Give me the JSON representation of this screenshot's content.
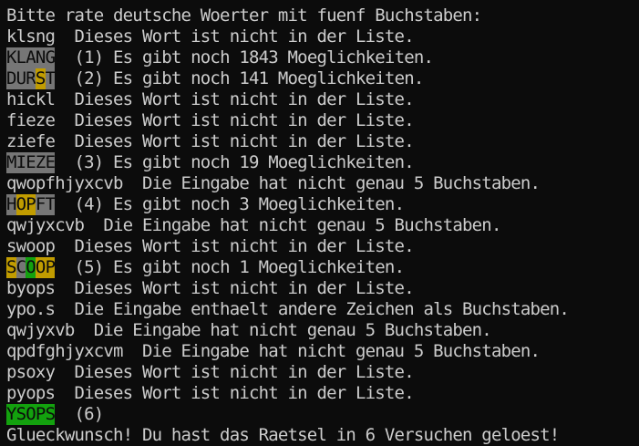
{
  "colors": {
    "background": "#0c0c0c",
    "foreground": "#cccccc",
    "absent": "#767676",
    "present": "#c19c00",
    "correct": "#13a10e"
  },
  "terminal": {
    "lines": [
      {
        "plain": "Bitte rate deutsche Woerter mit fuenf Buchstaben:"
      },
      {
        "plain": "klsng  Dieses Wort ist nicht in der Liste."
      },
      {
        "tiles": [
          {
            "ch": "K",
            "state": "absent"
          },
          {
            "ch": "L",
            "state": "absent"
          },
          {
            "ch": "A",
            "state": "absent"
          },
          {
            "ch": "N",
            "state": "absent"
          },
          {
            "ch": "G",
            "state": "absent"
          }
        ],
        "message": "  (1) Es gibt noch 1843 Moeglichkeiten."
      },
      {
        "tiles": [
          {
            "ch": "D",
            "state": "absent"
          },
          {
            "ch": "U",
            "state": "absent"
          },
          {
            "ch": "R",
            "state": "absent"
          },
          {
            "ch": "S",
            "state": "present"
          },
          {
            "ch": "T",
            "state": "absent"
          }
        ],
        "message": "  (2) Es gibt noch 141 Moeglichkeiten."
      },
      {
        "plain": "hickl  Dieses Wort ist nicht in der Liste."
      },
      {
        "plain": "fieze  Dieses Wort ist nicht in der Liste."
      },
      {
        "plain": "ziefe  Dieses Wort ist nicht in der Liste."
      },
      {
        "tiles": [
          {
            "ch": "M",
            "state": "absent"
          },
          {
            "ch": "I",
            "state": "absent"
          },
          {
            "ch": "E",
            "state": "absent"
          },
          {
            "ch": "Z",
            "state": "absent"
          },
          {
            "ch": "E",
            "state": "absent"
          }
        ],
        "message": "  (3) Es gibt noch 19 Moeglichkeiten."
      },
      {
        "plain": "qwopfhjyxcvb  Die Eingabe hat nicht genau 5 Buchstaben."
      },
      {
        "tiles": [
          {
            "ch": "H",
            "state": "absent"
          },
          {
            "ch": "O",
            "state": "present"
          },
          {
            "ch": "P",
            "state": "present"
          },
          {
            "ch": "F",
            "state": "absent"
          },
          {
            "ch": "T",
            "state": "absent"
          }
        ],
        "message": "  (4) Es gibt noch 3 Moeglichkeiten."
      },
      {
        "plain": "qwjyxcvb  Die Eingabe hat nicht genau 5 Buchstaben."
      },
      {
        "plain": "swoop  Dieses Wort ist nicht in der Liste."
      },
      {
        "tiles": [
          {
            "ch": "S",
            "state": "present"
          },
          {
            "ch": "C",
            "state": "absent"
          },
          {
            "ch": "O",
            "state": "correct"
          },
          {
            "ch": "O",
            "state": "present"
          },
          {
            "ch": "P",
            "state": "present"
          }
        ],
        "message": "  (5) Es gibt noch 1 Moeglichkeiten."
      },
      {
        "plain": "byops  Dieses Wort ist nicht in der Liste."
      },
      {
        "plain": "ypo.s  Die Eingabe enthaelt andere Zeichen als Buchstaben."
      },
      {
        "plain": "qwjyxvb  Die Eingabe hat nicht genau 5 Buchstaben."
      },
      {
        "plain": "qpdfghjyxcvm  Die Eingabe hat nicht genau 5 Buchstaben."
      },
      {
        "plain": "psoxy  Dieses Wort ist nicht in der Liste."
      },
      {
        "plain": "pyops  Dieses Wort ist nicht in der Liste."
      },
      {
        "tiles": [
          {
            "ch": "Y",
            "state": "correct"
          },
          {
            "ch": "S",
            "state": "correct"
          },
          {
            "ch": "O",
            "state": "correct"
          },
          {
            "ch": "P",
            "state": "correct"
          },
          {
            "ch": "S",
            "state": "correct"
          }
        ],
        "message": "  (6)"
      },
      {
        "plain": "Glueckwunsch! Du hast das Raetsel in 6 Versuchen geloest!"
      }
    ]
  }
}
